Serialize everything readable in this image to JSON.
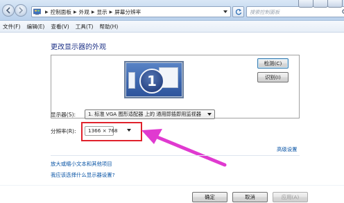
{
  "address": {
    "crumbs": [
      "控制面板",
      "外观",
      "显示",
      "屏幕分辨率"
    ],
    "search_placeholder": "搜索控制面板"
  },
  "menu": [
    "文件(F)",
    "编辑(E)",
    "查看(V)",
    "工具(T)",
    "帮助(H)"
  ],
  "main": {
    "title": "更改显示器的外观",
    "monitor_number": "1",
    "detect_label": "检测(C)",
    "identify_label": "识别(I)",
    "display_label": "显示器(S):",
    "display_value": "1. 标准 VGA 图形适配器 上的 通用即插即用监视器",
    "resolution_label": "分辨率(R):",
    "resolution_value": "1366 × 768",
    "advanced_link": "高级设置",
    "textsize_link": "放大或缩小文本和其他项目",
    "whichsetting_link": "我应该选择什么显示器设置?"
  },
  "footer": {
    "ok_label": "确定",
    "cancel_label": "取消",
    "apply_label": "应用(A)"
  },
  "colors": {
    "title": "#1e3287",
    "link": "#0a55a6",
    "highlight": "#e0222c",
    "arrow": "#e03ad0"
  },
  "icons": [
    "back-icon",
    "forward-icon",
    "control-panel-icon",
    "refresh-icon",
    "search-icon",
    "dropdown-icon",
    "arrow-annotation-icon"
  ]
}
